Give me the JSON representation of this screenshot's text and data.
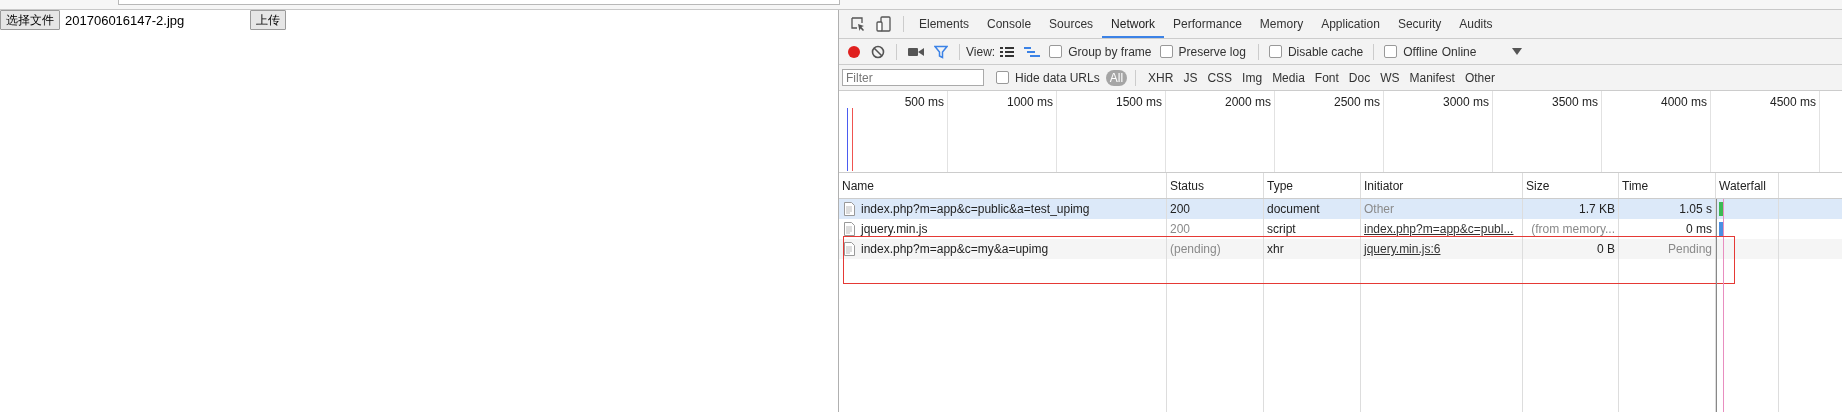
{
  "page": {
    "file_button": "选择文件",
    "file_name": "201706016147-2.jpg",
    "upload_button": "上传"
  },
  "devtools": {
    "tabs": [
      {
        "label": "Elements",
        "selected": false
      },
      {
        "label": "Console",
        "selected": false
      },
      {
        "label": "Sources",
        "selected": false
      },
      {
        "label": "Network",
        "selected": true
      },
      {
        "label": "Performance",
        "selected": false
      },
      {
        "label": "Memory",
        "selected": false
      },
      {
        "label": "Application",
        "selected": false
      },
      {
        "label": "Security",
        "selected": false
      },
      {
        "label": "Audits",
        "selected": false
      }
    ],
    "toolbar": {
      "recording": true,
      "filter_active": true,
      "view_label": "View:",
      "options": [
        {
          "label": "Group by frame",
          "checked": false
        },
        {
          "label": "Preserve log",
          "checked": false
        },
        {
          "label": "Disable cache",
          "checked": false
        },
        {
          "label": "Offline",
          "checked": false
        }
      ],
      "throttling": "Online"
    },
    "filter_bar": {
      "placeholder": "Filter",
      "hide_data_urls": {
        "label": "Hide data URLs",
        "checked": false
      },
      "types": [
        {
          "label": "All",
          "selected": true
        },
        {
          "label": "XHR",
          "selected": false
        },
        {
          "label": "JS",
          "selected": false
        },
        {
          "label": "CSS",
          "selected": false
        },
        {
          "label": "Img",
          "selected": false
        },
        {
          "label": "Media",
          "selected": false
        },
        {
          "label": "Font",
          "selected": false
        },
        {
          "label": "Doc",
          "selected": false
        },
        {
          "label": "WS",
          "selected": false
        },
        {
          "label": "Manifest",
          "selected": false
        },
        {
          "label": "Other",
          "selected": false
        }
      ]
    },
    "timeline": {
      "ticks": [
        "500 ms",
        "1000 ms",
        "1500 ms",
        "2000 ms",
        "2500 ms",
        "3000 ms",
        "3500 ms",
        "4000 ms",
        "4500 ms"
      ]
    },
    "table": {
      "columns": [
        "Name",
        "Status",
        "Type",
        "Initiator",
        "Size",
        "Time",
        "Waterfall"
      ],
      "rows": [
        {
          "selected": true,
          "highlighted": false,
          "color": "#3cba54",
          "cells": [
            {
              "text": "index.php?m=app&c=public&a=test_upimg",
              "kind": "plain"
            },
            {
              "text": "200",
              "kind": "plain"
            },
            {
              "text": "document",
              "kind": "plain"
            },
            {
              "text": "Other",
              "kind": "dim"
            },
            {
              "text": "1.7 KB",
              "kind": "plain"
            },
            {
              "text": "1.05 s",
              "kind": "plain"
            }
          ]
        },
        {
          "selected": false,
          "highlighted": false,
          "color": "#4a90e2",
          "cells": [
            {
              "text": "jquery.min.js",
              "kind": "plain"
            },
            {
              "text": "200",
              "kind": "dim"
            },
            {
              "text": "script",
              "kind": "plain"
            },
            {
              "text": "index.php?m=app&c=publ...",
              "kind": "link"
            },
            {
              "text": "(from memory...",
              "kind": "dim"
            },
            {
              "text": "0 ms",
              "kind": "plain"
            }
          ]
        },
        {
          "selected": false,
          "highlighted": true,
          "cells": [
            {
              "text": "index.php?m=app&c=my&a=upimg",
              "kind": "plain"
            },
            {
              "text": "(pending)",
              "kind": "dim"
            },
            {
              "text": "xhr",
              "kind": "plain"
            },
            {
              "text": "jquery.min.js:6",
              "kind": "link"
            },
            {
              "text": "0 B",
              "kind": "plain"
            },
            {
              "text": "Pending",
              "kind": "dim"
            }
          ]
        }
      ]
    }
  }
}
